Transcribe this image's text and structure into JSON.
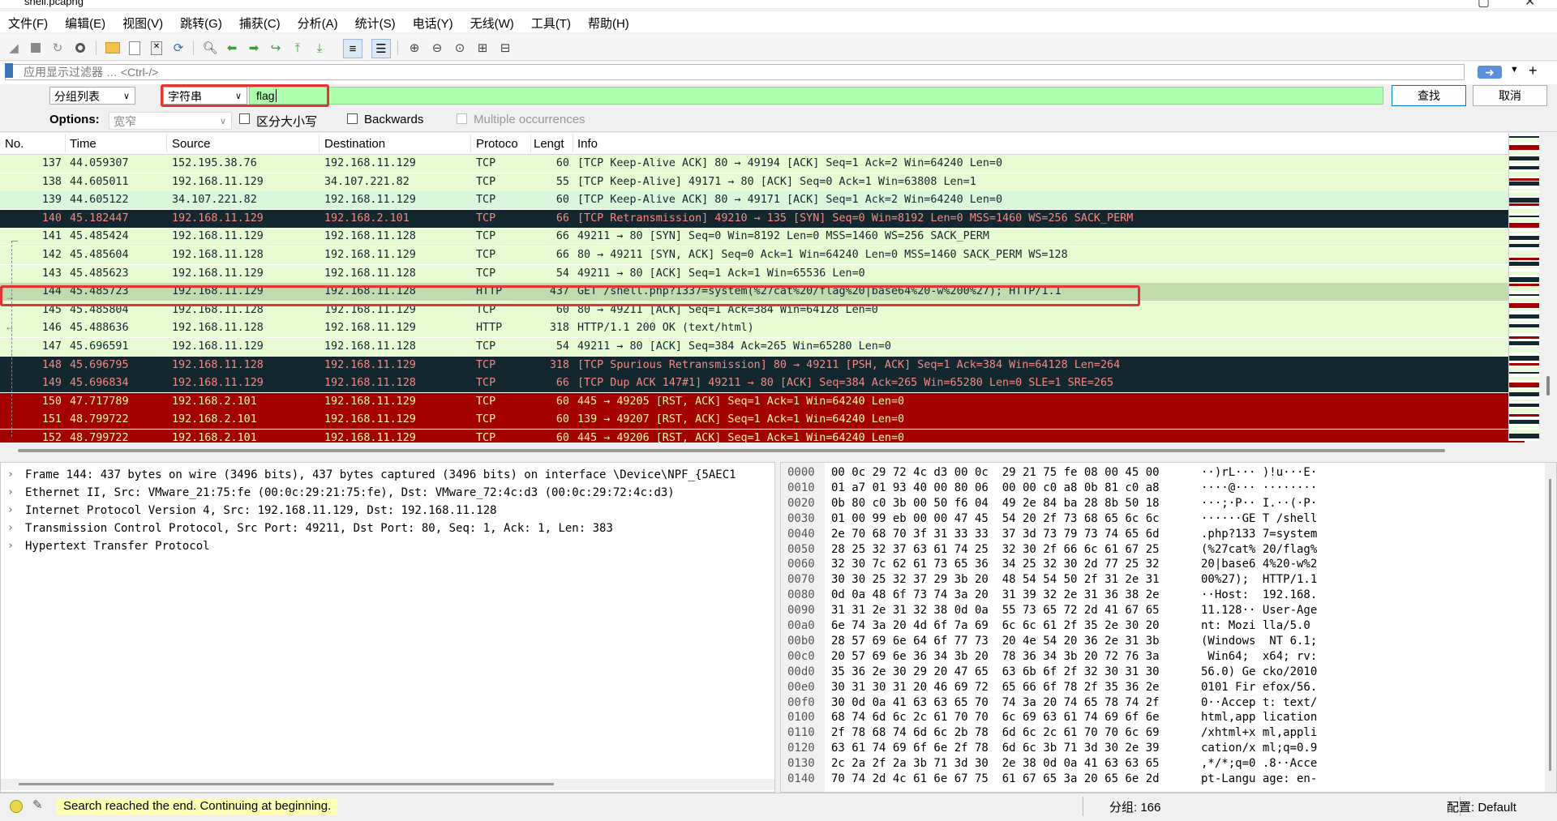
{
  "window": {
    "title": "shell.pcapng"
  },
  "menu": [
    "文件(F)",
    "编辑(E)",
    "视图(V)",
    "跳转(G)",
    "捕获(C)",
    "分析(A)",
    "统计(S)",
    "电话(Y)",
    "无线(W)",
    "工具(T)",
    "帮助(H)"
  ],
  "display_filter": {
    "placeholder": "应用显示过滤器 … <Ctrl-/>",
    "apply_icon": "arrow-right-icon"
  },
  "find": {
    "search_in": "分组列表",
    "search_type": "字符串",
    "search_value": "flag",
    "find_label": "查找",
    "cancel_label": "取消",
    "options_label": "Options:",
    "charset": "宽窄",
    "case_sensitive_label": "区分大小写",
    "backwards_label": "Backwards",
    "multiple_label": "Multiple occurrences"
  },
  "packet_list": {
    "columns": [
      "No.",
      "Time",
      "Source",
      "Destination",
      "Protoco",
      "Lengt",
      "Info"
    ],
    "rows": [
      {
        "no": "137",
        "time": "44.059307",
        "src": "152.195.38.76",
        "dst": "192.168.11.129",
        "proto": "TCP",
        "len": "60",
        "info": "[TCP Keep-Alive ACK] 80 → 49194 [ACK] Seq=1 Ack=2 Win=64240 Len=0",
        "style": "tcp"
      },
      {
        "no": "138",
        "time": "44.605011",
        "src": "192.168.11.129",
        "dst": "34.107.221.82",
        "proto": "TCP",
        "len": "55",
        "info": "[TCP Keep-Alive] 49171 → 80 [ACK] Seq=0 Ack=1 Win=63808 Len=1",
        "style": "tcp"
      },
      {
        "no": "139",
        "time": "44.605122",
        "src": "34.107.221.82",
        "dst": "192.168.11.129",
        "proto": "TCP",
        "len": "60",
        "info": "[TCP Keep-Alive ACK] 80 → 49171 [ACK] Seq=1 Ack=2 Win=64240 Len=0",
        "style": "tcp2"
      },
      {
        "no": "140",
        "time": "45.182447",
        "src": "192.168.11.129",
        "dst": "192.168.2.101",
        "proto": "TCP",
        "len": "66",
        "info": "[TCP Retransmission] 49210 → 135 [SYN] Seq=0 Win=8192 Len=0 MSS=1460 WS=256 SACK_PERM",
        "style": "bad"
      },
      {
        "no": "141",
        "time": "45.485424",
        "src": "192.168.11.129",
        "dst": "192.168.11.128",
        "proto": "TCP",
        "len": "66",
        "info": "49211 → 80 [SYN] Seq=0 Win=8192 Len=0 MSS=1460 WS=256 SACK_PERM",
        "style": "tcp"
      },
      {
        "no": "142",
        "time": "45.485604",
        "src": "192.168.11.128",
        "dst": "192.168.11.129",
        "proto": "TCP",
        "len": "66",
        "info": "80 → 49211 [SYN, ACK] Seq=0 Ack=1 Win=64240 Len=0 MSS=1460 SACK_PERM WS=128",
        "style": "tcp"
      },
      {
        "no": "143",
        "time": "45.485623",
        "src": "192.168.11.129",
        "dst": "192.168.11.128",
        "proto": "TCP",
        "len": "54",
        "info": "49211 → 80 [ACK] Seq=1 Ack=1 Win=65536 Len=0",
        "style": "tcp"
      },
      {
        "no": "144",
        "time": "45.485723",
        "src": "192.168.11.129",
        "dst": "192.168.11.128",
        "proto": "HTTP",
        "len": "437",
        "info": "GET /shell.php?1337=system(%27cat%20/flag%20|base64%20-w%200%27); HTTP/1.1",
        "style": "sel"
      },
      {
        "no": "145",
        "time": "45.485804",
        "src": "192.168.11.128",
        "dst": "192.168.11.129",
        "proto": "TCP",
        "len": "60",
        "info": "80 → 49211 [ACK] Seq=1 Ack=384 Win=64128 Len=0",
        "style": "tcp"
      },
      {
        "no": "146",
        "time": "45.488636",
        "src": "192.168.11.128",
        "dst": "192.168.11.129",
        "proto": "HTTP",
        "len": "318",
        "info": "HTTP/1.1 200 OK  (text/html)",
        "style": "tcp"
      },
      {
        "no": "147",
        "time": "45.696591",
        "src": "192.168.11.129",
        "dst": "192.168.11.128",
        "proto": "TCP",
        "len": "54",
        "info": "49211 → 80 [ACK] Seq=384 Ack=265 Win=65280 Len=0",
        "style": "tcp"
      },
      {
        "no": "148",
        "time": "45.696795",
        "src": "192.168.11.128",
        "dst": "192.168.11.129",
        "proto": "TCP",
        "len": "318",
        "info": "[TCP Spurious Retransmission] 80 → 49211 [PSH, ACK] Seq=1 Ack=384 Win=64128 Len=264",
        "style": "bad"
      },
      {
        "no": "149",
        "time": "45.696834",
        "src": "192.168.11.129",
        "dst": "192.168.11.128",
        "proto": "TCP",
        "len": "66",
        "info": "[TCP Dup ACK 147#1] 49211 → 80 [ACK] Seq=384 Ack=265 Win=65280 Len=0 SLE=1 SRE=265",
        "style": "bad"
      },
      {
        "no": "150",
        "time": "47.717789",
        "src": "192.168.2.101",
        "dst": "192.168.11.129",
        "proto": "TCP",
        "len": "60",
        "info": "445 → 49205 [RST, ACK] Seq=1 Ack=1 Win=64240 Len=0",
        "style": "rst"
      },
      {
        "no": "151",
        "time": "48.799722",
        "src": "192.168.2.101",
        "dst": "192.168.11.129",
        "proto": "TCP",
        "len": "60",
        "info": "139 → 49207 [RST, ACK] Seq=1 Ack=1 Win=64240 Len=0",
        "style": "rst"
      },
      {
        "no": "152",
        "time": "48.799722",
        "src": "192.168.2.101",
        "dst": "192.168.11.129",
        "proto": "TCP",
        "len": "60",
        "info": "445 → 49206 [RST, ACK] Seq=1 Ack=1 Win=64240 Len=0",
        "style": "rst"
      }
    ]
  },
  "row_styles": {
    "tcp": {
      "bg": "#e7fcd2",
      "fg": "#12272e"
    },
    "tcp2": {
      "bg": "#d9f7da",
      "fg": "#12272e"
    },
    "bad": {
      "bg": "#12272e",
      "fg": "#f78787"
    },
    "rst": {
      "bg": "#a40000",
      "fg": "#fffc9c"
    },
    "sel": {
      "bg": "#c2dbac",
      "fg": "#12272e"
    }
  },
  "details": [
    "Frame 144: 437 bytes on wire (3496 bits), 437 bytes captured (3496 bits) on interface \\Device\\NPF_{5AEC1",
    "Ethernet II, Src: VMware_21:75:fe (00:0c:29:21:75:fe), Dst: VMware_72:4c:d3 (00:0c:29:72:4c:d3)",
    "Internet Protocol Version 4, Src: 192.168.11.129, Dst: 192.168.11.128",
    "Transmission Control Protocol, Src Port: 49211, Dst Port: 80, Seq: 1, Ack: 1, Len: 383",
    "Hypertext Transfer Protocol"
  ],
  "bytes": [
    {
      "off": "0000",
      "hex": "00 0c 29 72 4c d3 00 0c  29 21 75 fe 08 00 45 00",
      "asc": "··)rL··· )!u···E·"
    },
    {
      "off": "0010",
      "hex": "01 a7 01 93 40 00 80 06  00 00 c0 a8 0b 81 c0 a8",
      "asc": "····@··· ········"
    },
    {
      "off": "0020",
      "hex": "0b 80 c0 3b 00 50 f6 04  49 2e 84 ba 28 8b 50 18",
      "asc": "···;·P·· I.··(·P·"
    },
    {
      "off": "0030",
      "hex": "01 00 99 eb 00 00 47 45  54 20 2f 73 68 65 6c 6c",
      "asc": "······GE T /shell"
    },
    {
      "off": "0040",
      "hex": "2e 70 68 70 3f 31 33 33  37 3d 73 79 73 74 65 6d",
      "asc": ".php?133 7=system"
    },
    {
      "off": "0050",
      "hex": "28 25 32 37 63 61 74 25  32 30 2f 66 6c 61 67 25",
      "asc": "(%27cat% 20/flag%"
    },
    {
      "off": "0060",
      "hex": "32 30 7c 62 61 73 65 36  34 25 32 30 2d 77 25 32",
      "asc": "20|base6 4%20-w%2"
    },
    {
      "off": "0070",
      "hex": "30 30 25 32 37 29 3b 20  48 54 54 50 2f 31 2e 31",
      "asc": "00%27);  HTTP/1.1"
    },
    {
      "off": "0080",
      "hex": "0d 0a 48 6f 73 74 3a 20  31 39 32 2e 31 36 38 2e",
      "asc": "··Host:  192.168."
    },
    {
      "off": "0090",
      "hex": "31 31 2e 31 32 38 0d 0a  55 73 65 72 2d 41 67 65",
      "asc": "11.128·· User-Age"
    },
    {
      "off": "00a0",
      "hex": "6e 74 3a 20 4d 6f 7a 69  6c 6c 61 2f 35 2e 30 20",
      "asc": "nt: Mozi lla/5.0 "
    },
    {
      "off": "00b0",
      "hex": "28 57 69 6e 64 6f 77 73  20 4e 54 20 36 2e 31 3b",
      "asc": "(Windows  NT 6.1;"
    },
    {
      "off": "00c0",
      "hex": "20 57 69 6e 36 34 3b 20  78 36 34 3b 20 72 76 3a",
      "asc": " Win64;  x64; rv:"
    },
    {
      "off": "00d0",
      "hex": "35 36 2e 30 29 20 47 65  63 6b 6f 2f 32 30 31 30",
      "asc": "56.0) Ge cko/2010"
    },
    {
      "off": "00e0",
      "hex": "30 31 30 31 20 46 69 72  65 66 6f 78 2f 35 36 2e",
      "asc": "0101 Fir efox/56."
    },
    {
      "off": "00f0",
      "hex": "30 0d 0a 41 63 63 65 70  74 3a 20 74 65 78 74 2f",
      "asc": "0··Accep t: text/"
    },
    {
      "off": "0100",
      "hex": "68 74 6d 6c 2c 61 70 70  6c 69 63 61 74 69 6f 6e",
      "asc": "html,app lication"
    },
    {
      "off": "0110",
      "hex": "2f 78 68 74 6d 6c 2b 78  6d 6c 2c 61 70 70 6c 69",
      "asc": "/xhtml+x ml,appli"
    },
    {
      "off": "0120",
      "hex": "63 61 74 69 6f 6e 2f 78  6d 6c 3b 71 3d 30 2e 39",
      "asc": "cation/x ml;q=0.9"
    },
    {
      "off": "0130",
      "hex": "2c 2a 2f 2a 3b 71 3d 30  2e 38 0d 0a 41 63 63 65",
      "asc": ",*/*;q=0 .8··Acce"
    },
    {
      "off": "0140",
      "hex": "70 74 2d 4c 61 6e 67 75  61 67 65 3a 20 65 6e 2d",
      "asc": "pt-Langu age: en-"
    }
  ],
  "status": {
    "message": "Search reached the end. Continuing at beginning.",
    "packets": "分组: 166",
    "profile": "配置: Default"
  }
}
